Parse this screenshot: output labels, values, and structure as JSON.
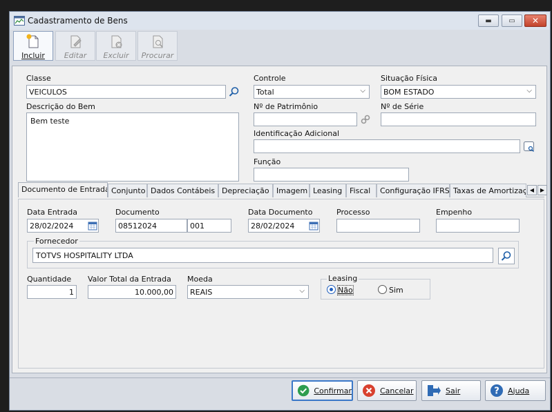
{
  "window": {
    "title": "Cadastramento de Bens"
  },
  "toolbar": {
    "incluir": "Incluir",
    "editar": "Editar",
    "excluir": "Excluir",
    "procurar": "Procurar"
  },
  "form": {
    "classe": {
      "label": "Classe",
      "value": "VEICULOS"
    },
    "controle": {
      "label": "Controle",
      "value": "Total"
    },
    "situacao": {
      "label": "Situação Física",
      "value": "BOM ESTADO"
    },
    "descricao": {
      "label": "Descrição do Bem",
      "value": "Bem teste"
    },
    "patrimonio": {
      "label": "Nº de Patrimônio",
      "value": ""
    },
    "serie": {
      "label": "Nº de Série",
      "value": ""
    },
    "identificacao": {
      "label": "Identificação Adicional",
      "value": ""
    },
    "funcao": {
      "label": "Função",
      "value": ""
    }
  },
  "tabs": [
    "Documento de Entrada",
    "Conjunto",
    "Dados Contábeis",
    "Depreciação",
    "Imagem",
    "Leasing",
    "Fiscal",
    "Configuração IFRS",
    "Taxas de Amortizaçã"
  ],
  "doc": {
    "data_entrada": {
      "label": "Data Entrada",
      "value": "28/02/2024"
    },
    "documento": {
      "label": "Documento",
      "value": "08512024",
      "serie": "001"
    },
    "data_documento": {
      "label": "Data Documento",
      "value": "28/02/2024"
    },
    "processo": {
      "label": "Processo",
      "value": ""
    },
    "empenho": {
      "label": "Empenho",
      "value": ""
    },
    "fornecedor": {
      "label": "Fornecedor",
      "value": "TOTVS HOSPITALITY LTDA"
    },
    "quantidade": {
      "label": "Quantidade",
      "value": "1"
    },
    "valor_total": {
      "label": "Valor Total da Entrada",
      "value": "10.000,00"
    },
    "moeda": {
      "label": "Moeda",
      "value": "REAIS"
    },
    "leasing": {
      "label": "Leasing",
      "nao": "Não",
      "sim": "Sim",
      "selected": "Não"
    }
  },
  "footer": {
    "confirmar": "Confirmar",
    "cancelar": "Cancelar",
    "sair": "Sair",
    "ajuda": "Ajuda"
  },
  "icons": {
    "app": "chart-window-icon",
    "incluir": "new-document-icon",
    "editar": "edit-document-icon",
    "excluir": "delete-document-icon",
    "procurar": "search-document-icon"
  }
}
